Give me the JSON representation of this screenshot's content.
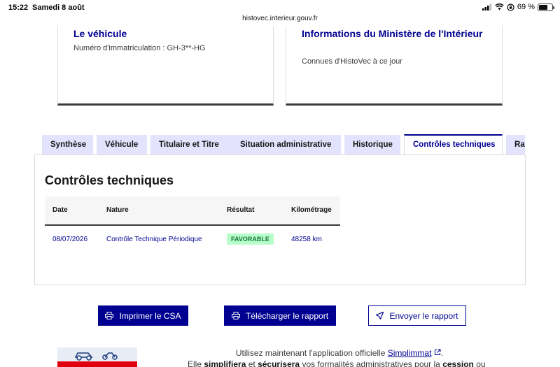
{
  "status_bar": {
    "time": "15:22",
    "date": "Samedi 8 août",
    "url": "histovec.interieur.gouv.fr",
    "battery": "69 %",
    "battery_level": 0.69
  },
  "cards": {
    "vehicle": {
      "title": "Le véhicule",
      "text": "Numéro d'immatriculation : GH-3**-HG"
    },
    "ministry": {
      "title": "Informations du Ministère de l'Intérieur",
      "text": "Connues d'HistoVec à ce jour"
    }
  },
  "tabs": [
    {
      "label": "Synthèse",
      "active": false
    },
    {
      "label": "Véhicule",
      "active": false
    },
    {
      "label": "Titulaire et Titre",
      "active": false
    },
    {
      "label": "Situation administrative",
      "active": false
    },
    {
      "label": "Historique",
      "active": false
    },
    {
      "label": "Contrôles techniques",
      "active": true
    },
    {
      "label": "Rap",
      "active": false
    }
  ],
  "panel": {
    "title": "Contrôles techniques",
    "columns": [
      "Date",
      "Nature",
      "Résultat",
      "Kilométrage"
    ],
    "rows": [
      {
        "date": "08/07/2026",
        "nature": "Contrôle Technique Périodique",
        "result": "FAVORABLE",
        "mileage": "48258 km"
      }
    ]
  },
  "actions": {
    "print": "Imprimer le CSA",
    "download": "Télécharger le rapport",
    "send": "Envoyer le rapport"
  },
  "promo": {
    "line1_prefix": "Utilisez maintenant l'application officielle ",
    "link": "Simplimmat",
    "line1_suffix": ".",
    "line2_a": "Elle ",
    "line2_b": "simplifiera",
    "line2_c": " et ",
    "line2_d": "sécurisera",
    "line2_e": " vos formalités administratives pour la ",
    "line2_f": "cession",
    "line2_g": " ou"
  },
  "colors": {
    "primary": "#000091",
    "tab_bg": "#e3e3fd",
    "success_bg": "#b8fec9",
    "success_text": "#18753c"
  }
}
